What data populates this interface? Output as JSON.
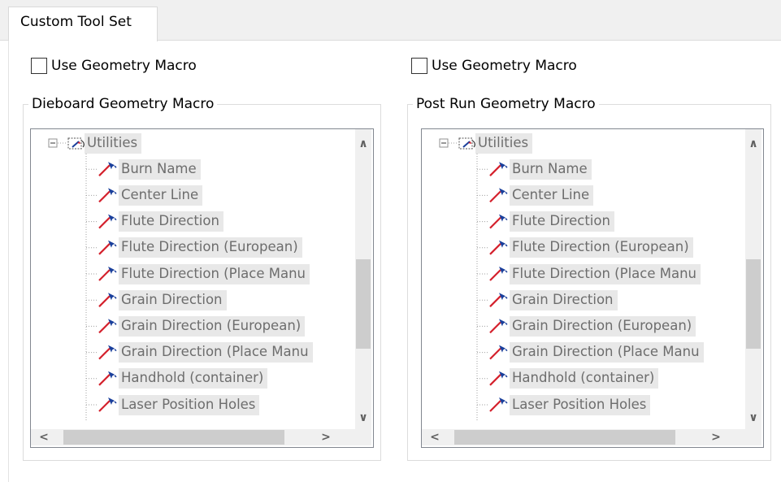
{
  "tab": {
    "label": "Custom Tool Set"
  },
  "left": {
    "checkbox_label": "Use Geometry Macro",
    "checked": false,
    "group_title": "Dieboard Geometry Macro",
    "root": "Utilities",
    "items": [
      "Burn Name",
      "Center Line",
      "Flute Direction",
      "Flute Direction (European)",
      "Flute Direction (Place Manu",
      "Grain Direction",
      "Grain Direction (European)",
      "Grain Direction (Place Manu",
      "Handhold (container)",
      "Laser Position Holes"
    ]
  },
  "right": {
    "checkbox_label": "Use Geometry Macro",
    "checked": false,
    "group_title": "Post Run Geometry Macro",
    "root": "Utilities",
    "items": [
      "Burn Name",
      "Center Line",
      "Flute Direction",
      "Flute Direction (European)",
      "Flute Direction (Place Manu",
      "Grain Direction",
      "Grain Direction (European)",
      "Grain Direction (Place Manu",
      "Handhold (container)",
      "Laser Position Holes"
    ]
  },
  "colors": {
    "wand_red": "#d4202c",
    "wand_blue": "#1a3f9b",
    "tree_line": "#a0a0a0",
    "selection_bg": "#e8e8e8"
  }
}
